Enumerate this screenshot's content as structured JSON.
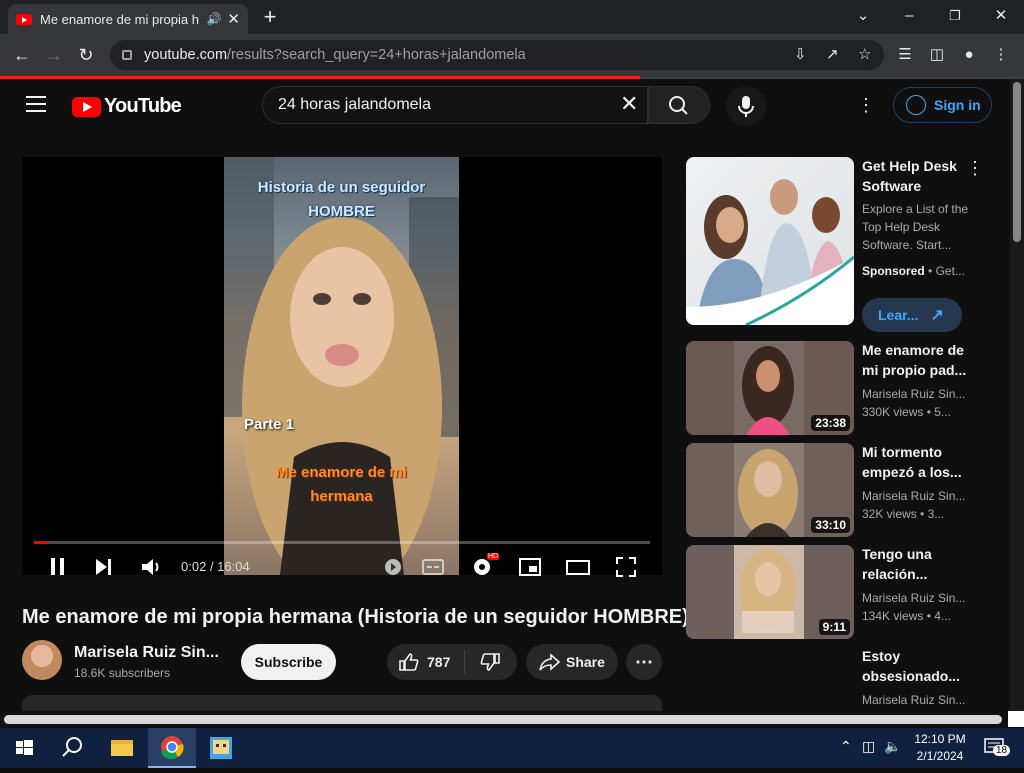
{
  "browser": {
    "tab_title": "Me enamore de mi propia h",
    "url_host": "youtube.com",
    "url_path": "/results?search_query=24+horas+jalandomela"
  },
  "youtube": {
    "logo_text": "YouTube",
    "search_value": "24 horas jalandomela",
    "signin_label": "Sign in",
    "load_progress": 0.625
  },
  "video": {
    "caption_top_1": "Historia de un seguidor",
    "caption_top_2": "HOMBRE",
    "caption_part": "Parte 1",
    "caption_bottom_1": "Me enamore de mi",
    "caption_bottom_2": "hermana",
    "time_current": "0:02",
    "time_total": "16:04",
    "hd_badge": "HD",
    "title": "Me enamore de mi propia hermana (Historia de un seguidor HOMBRE)",
    "channel_name": "Marisela Ruiz Sin...",
    "subscribers": "18.6K subscribers",
    "subscribe_label": "Subscribe",
    "likes": "787",
    "share_label": "Share"
  },
  "sidebar": {
    "ad": {
      "title": "Get Help Desk Software",
      "description": "Explore a List of the Top Help Desk Software. Start...",
      "sponsored": "Sponsored",
      "advertiser": "Get...",
      "cta": "Lear..."
    },
    "items": [
      {
        "title": "Me enamore de mi propio pad...",
        "channel": "Marisela Ruiz Sin...",
        "views": "330K views",
        "age": "5...",
        "duration": "23:38"
      },
      {
        "title": "Mi tormento empezó a los...",
        "channel": "Marisela Ruiz Sin...",
        "views": "32K views",
        "age": "3...",
        "duration": "33:10"
      },
      {
        "title": "Tengo una relación...",
        "channel": "Marisela Ruiz Sin...",
        "views": "134K views",
        "age": "4...",
        "duration": "9:11"
      },
      {
        "title": "Estoy obsesionado...",
        "channel": "Marisela Ruiz Sin...",
        "views": "",
        "age": "",
        "duration": ""
      }
    ]
  },
  "taskbar": {
    "time": "12:10 PM",
    "date": "2/1/2024",
    "notifications": "18"
  }
}
